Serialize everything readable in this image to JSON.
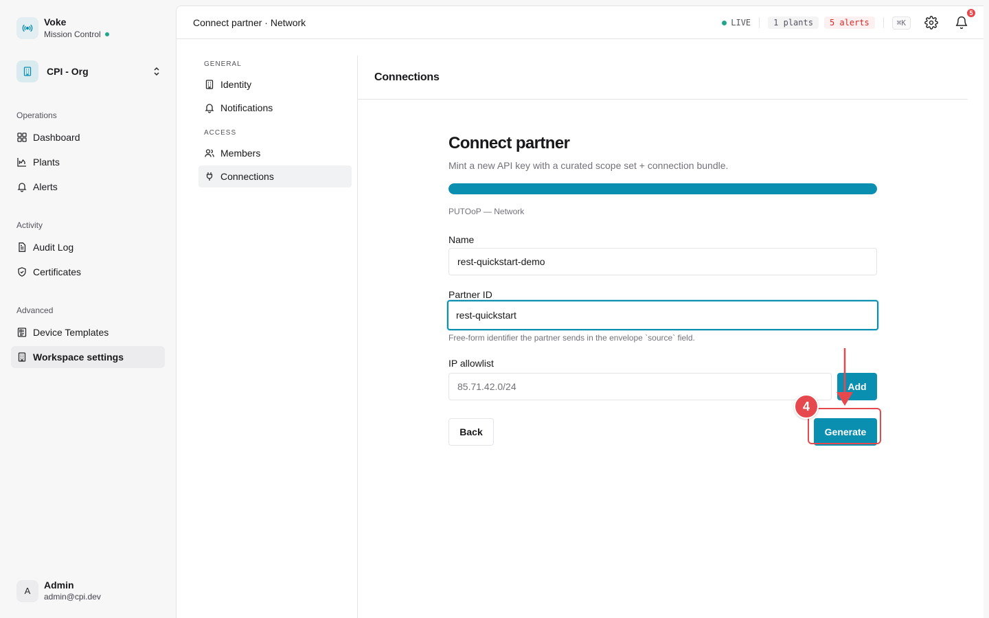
{
  "brand": {
    "name": "Voke",
    "subtitle": "Mission Control"
  },
  "org": {
    "name": "CPI - Org"
  },
  "sidebar": {
    "sections": [
      {
        "title": "Operations",
        "items": [
          {
            "label": "Dashboard",
            "icon": "dashboard-icon"
          },
          {
            "label": "Plants",
            "icon": "chart-icon"
          },
          {
            "label": "Alerts",
            "icon": "bell-icon"
          }
        ]
      },
      {
        "title": "Activity",
        "items": [
          {
            "label": "Audit Log",
            "icon": "document-icon"
          },
          {
            "label": "Certificates",
            "icon": "shield-icon"
          }
        ]
      },
      {
        "title": "Advanced",
        "items": [
          {
            "label": "Device Templates",
            "icon": "template-icon"
          },
          {
            "label": "Workspace settings",
            "icon": "building-icon",
            "active": true
          }
        ]
      }
    ]
  },
  "user": {
    "initial": "A",
    "name": "Admin",
    "email": "admin@cpi.dev"
  },
  "topbar": {
    "breadcrumb": "Connect partner · Network",
    "live": "LIVE",
    "plants": "1 plants",
    "alerts": "5 alerts",
    "shortcut": "⌘K",
    "notif_count": "5"
  },
  "settings_nav": {
    "general_title": "GENERAL",
    "general_items": [
      {
        "label": "Identity"
      },
      {
        "label": "Notifications"
      }
    ],
    "access_title": "ACCESS",
    "access_items": [
      {
        "label": "Members"
      },
      {
        "label": "Connections",
        "active": true
      }
    ]
  },
  "content": {
    "heading": "Connections",
    "form": {
      "title": "Connect partner",
      "subtitle": "Mint a new API key with a curated scope set + connection bundle.",
      "progress": 1.0,
      "step_caption": "PUTOoP — Network",
      "name_label": "Name",
      "name_value": "rest-quickstart-demo",
      "partner_label": "Partner ID",
      "partner_value": "rest-quickstart",
      "partner_hint": "Free-form identifier the partner sends in the envelope `source` field.",
      "ip_label": "IP allowlist",
      "ip_placeholder": "85.71.42.0/24",
      "add_label": "Add",
      "back_label": "Back",
      "generate_label": "Generate"
    }
  },
  "annotation": {
    "step": "4",
    "color": "#e5484d"
  },
  "colors": {
    "accent": "#0b8fb0",
    "live": "#22a58a",
    "alert": "#dc2626"
  }
}
